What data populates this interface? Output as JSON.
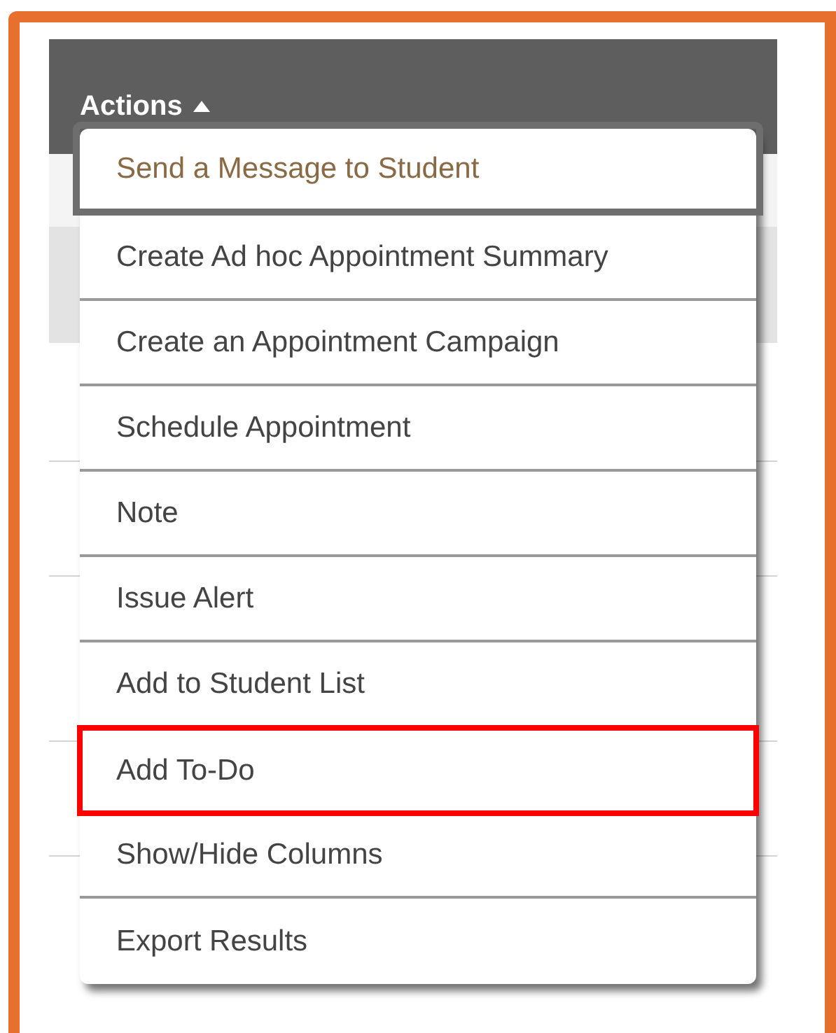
{
  "header": {
    "label": "Actions",
    "expanded": true
  },
  "menu": [
    {
      "label": "Send a Message to Student",
      "focused": true,
      "highlighted": false
    },
    {
      "label": "Create Ad hoc Appointment Summary",
      "focused": false,
      "highlighted": false
    },
    {
      "label": "Create an Appointment Campaign",
      "focused": false,
      "highlighted": false
    },
    {
      "label": "Schedule Appointment",
      "focused": false,
      "highlighted": false
    },
    {
      "label": "Note",
      "focused": false,
      "highlighted": false
    },
    {
      "label": "Issue Alert",
      "focused": false,
      "highlighted": false
    },
    {
      "label": "Add to Student List",
      "focused": false,
      "highlighted": false
    },
    {
      "label": "Add To-Do",
      "focused": false,
      "highlighted": true
    },
    {
      "label": "Show/Hide Columns",
      "focused": false,
      "highlighted": false
    },
    {
      "label": "Export Results",
      "focused": false,
      "highlighted": false
    }
  ]
}
